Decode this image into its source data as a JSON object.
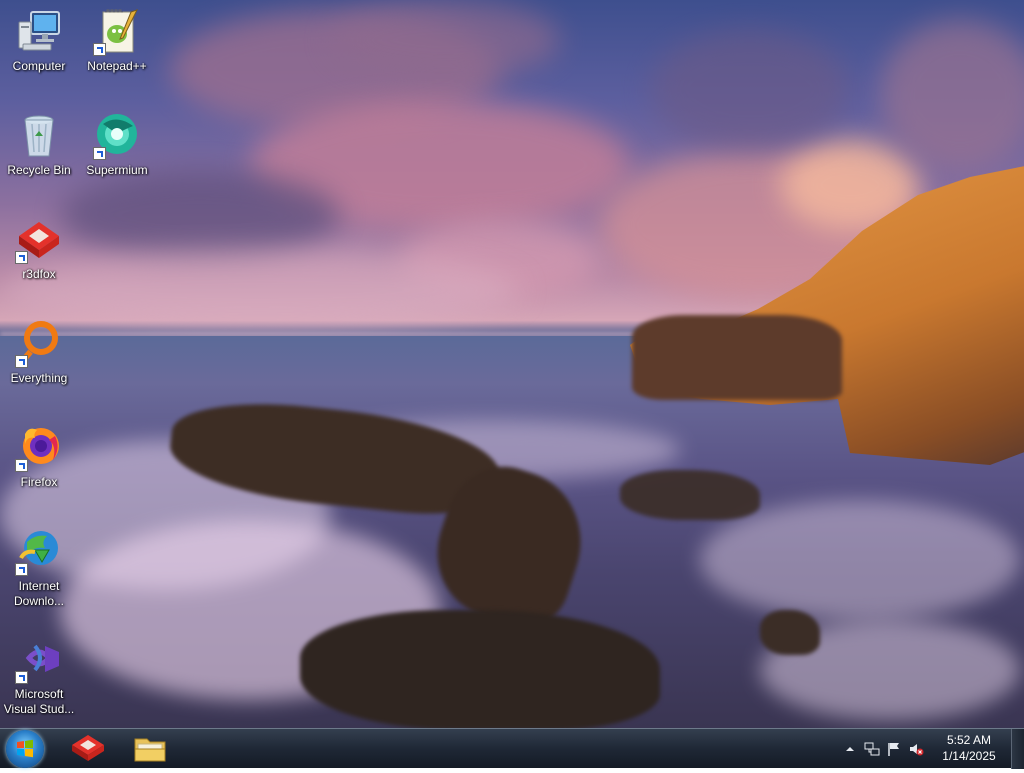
{
  "desktop": {
    "icons": [
      {
        "label": "Computer",
        "icon": "computer-icon"
      },
      {
        "label": "Notepad++",
        "icon": "notepad-plus-plus-icon"
      },
      {
        "label": "Recycle Bin",
        "icon": "recycle-bin-icon"
      },
      {
        "label": "Supermium",
        "icon": "supermium-icon"
      },
      {
        "label": "r3dfox",
        "icon": "r3dfox-icon"
      },
      {
        "label": "Everything",
        "icon": "everything-icon"
      },
      {
        "label": "Firefox",
        "icon": "firefox-icon"
      },
      {
        "label": "Internet\nDownlo...",
        "icon": "internet-download-manager-icon"
      },
      {
        "label": "Microsoft\nVisual Stud...",
        "icon": "visual-studio-icon"
      }
    ]
  },
  "taskbar": {
    "start_icon": "windows-start-orb",
    "pinned": [
      {
        "icon": "r3dfox-icon"
      },
      {
        "icon": "file-explorer-icon"
      }
    ],
    "tray": {
      "icons": [
        "show-hidden-icons-chevron",
        "network-icon",
        "action-center-flag-icon",
        "volume-muted-icon"
      ],
      "time": "5:52 AM",
      "date": "1/14/2025"
    }
  }
}
